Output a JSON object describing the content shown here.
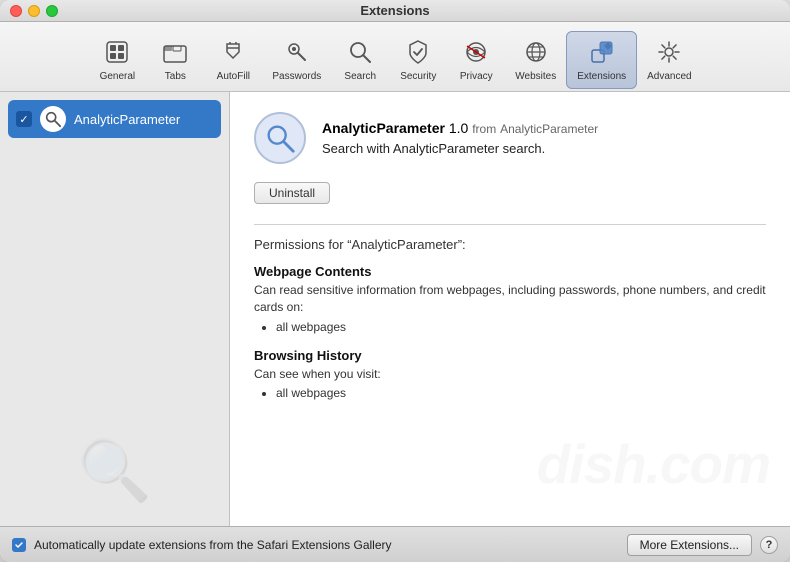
{
  "window": {
    "title": "Extensions"
  },
  "toolbar": {
    "items": [
      {
        "id": "general",
        "label": "General",
        "icon": "general"
      },
      {
        "id": "tabs",
        "label": "Tabs",
        "icon": "tabs"
      },
      {
        "id": "autofill",
        "label": "AutoFill",
        "icon": "autofill"
      },
      {
        "id": "passwords",
        "label": "Passwords",
        "icon": "passwords"
      },
      {
        "id": "search",
        "label": "Search",
        "icon": "search"
      },
      {
        "id": "security",
        "label": "Security",
        "icon": "security"
      },
      {
        "id": "privacy",
        "label": "Privacy",
        "icon": "privacy"
      },
      {
        "id": "websites",
        "label": "Websites",
        "icon": "websites"
      },
      {
        "id": "extensions",
        "label": "Extensions",
        "icon": "extensions",
        "active": true
      },
      {
        "id": "advanced",
        "label": "Advanced",
        "icon": "advanced"
      }
    ]
  },
  "sidebar": {
    "items": [
      {
        "id": "analyticparameter",
        "label": "AnalyticParameter",
        "checked": true
      }
    ]
  },
  "detail": {
    "ext_name": "AnalyticParameter",
    "ext_version": "1.0",
    "ext_from_label": "from",
    "ext_from": "AnalyticParameter",
    "ext_description": "Search with AnalyticParameter search.",
    "uninstall_label": "Uninstall",
    "permissions_header": "Permissions for “AnalyticParameter”:",
    "permissions": [
      {
        "title": "Webpage Contents",
        "desc": "Can read sensitive information from webpages, including passwords, phone numbers, and credit cards on:",
        "items": [
          "all webpages"
        ]
      },
      {
        "title": "Browsing History",
        "desc": "Can see when you visit:",
        "items": [
          "all webpages"
        ]
      }
    ]
  },
  "bottombar": {
    "auto_update_label": "Automatically update extensions from the Safari Extensions Gallery",
    "more_extensions_label": "More Extensions...",
    "help_label": "?"
  }
}
